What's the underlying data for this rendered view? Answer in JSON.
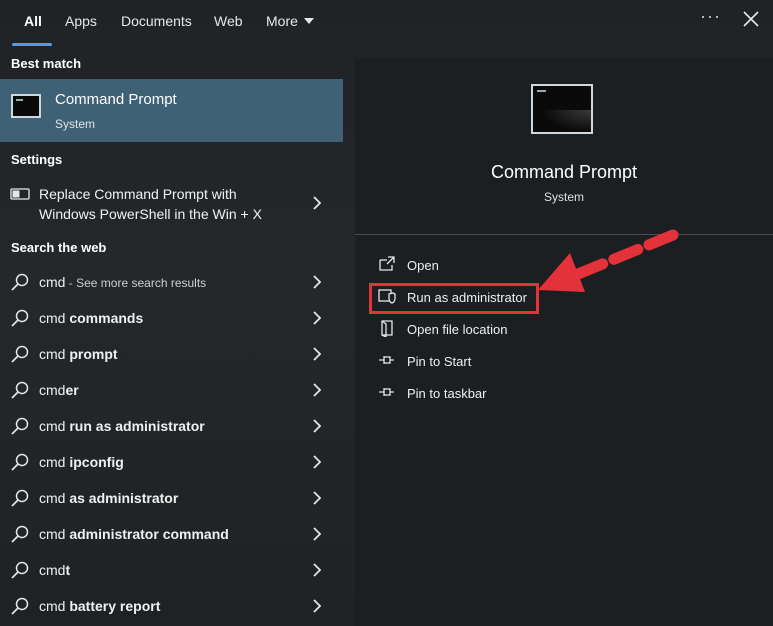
{
  "tabs": [
    {
      "label": "All",
      "active": true
    },
    {
      "label": "Apps"
    },
    {
      "label": "Documents"
    },
    {
      "label": "Web"
    },
    {
      "label": "More"
    }
  ],
  "left": {
    "best_match_heading": "Best match",
    "best_match": {
      "title": "Command Prompt",
      "subtitle": "System"
    },
    "settings_heading": "Settings",
    "settings_item": {
      "line1": "Replace Command Prompt with",
      "line2": "Windows PowerShell in the Win + X"
    },
    "web_heading": "Search the web",
    "web_results": [
      {
        "prefix": "cmd",
        "bold": "",
        "suffix": " - See more search results"
      },
      {
        "prefix": "cmd ",
        "bold": "commands",
        "suffix": ""
      },
      {
        "prefix": "cmd ",
        "bold": "prompt",
        "suffix": ""
      },
      {
        "prefix": "cmd",
        "bold": "er",
        "suffix": ""
      },
      {
        "prefix": "cmd ",
        "bold": "run as administrator",
        "suffix": ""
      },
      {
        "prefix": "cmd ",
        "bold": "ipconfig",
        "suffix": ""
      },
      {
        "prefix": "cmd ",
        "bold": "as administrator",
        "suffix": ""
      },
      {
        "prefix": "cmd ",
        "bold": "administrator command",
        "suffix": ""
      },
      {
        "prefix": "cmd",
        "bold": "t",
        "suffix": ""
      },
      {
        "prefix": "cmd ",
        "bold": "battery report",
        "suffix": ""
      }
    ]
  },
  "right": {
    "app_title": "Command Prompt",
    "app_subtitle": "System",
    "actions": [
      {
        "label": "Open",
        "icon": "open-icon"
      },
      {
        "label": "Run as administrator",
        "icon": "shield-icon"
      },
      {
        "label": "Open file location",
        "icon": "folder-icon"
      },
      {
        "label": "Pin to Start",
        "icon": "pin-icon"
      },
      {
        "label": "Pin to taskbar",
        "icon": "pin-icon"
      }
    ]
  },
  "colors": {
    "accent": "#4c9cf0",
    "selected": "#3e6176",
    "annotation": "#e3323a"
  }
}
